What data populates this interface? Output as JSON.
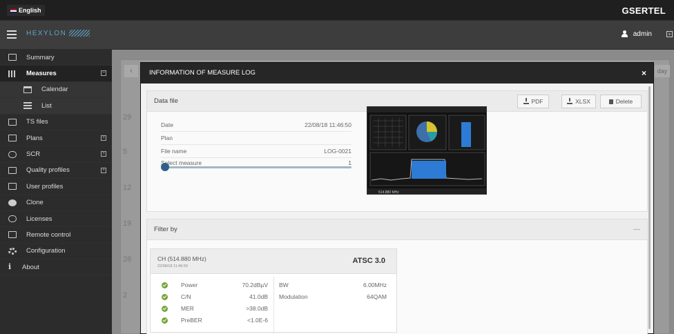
{
  "topbar": {
    "language": "English",
    "brand": "GSERTEL"
  },
  "header": {
    "logo_text": "HEXYLON",
    "user": "admin"
  },
  "sidebar": {
    "items": [
      {
        "label": "Summary",
        "icon": "summary-icon"
      },
      {
        "label": "Measures",
        "icon": "bar-chart-icon",
        "active": true,
        "expand": "⊟"
      },
      {
        "label": "Calendar",
        "icon": "calendar-icon",
        "sub": true
      },
      {
        "label": "List",
        "icon": "list-icon",
        "sub": true
      },
      {
        "label": "TS files",
        "icon": "ts-files-icon"
      },
      {
        "label": "Plans",
        "icon": "plans-icon",
        "expand": "⊞"
      },
      {
        "label": "SCR",
        "icon": "scr-icon",
        "expand": "⊞"
      },
      {
        "label": "Quality profiles",
        "icon": "quality-profiles-icon",
        "expand": "⊞"
      },
      {
        "label": "User profiles",
        "icon": "user-profiles-icon"
      },
      {
        "label": "Clone",
        "icon": "clone-icon"
      },
      {
        "label": "Licenses",
        "icon": "licenses-icon"
      },
      {
        "label": "Remote control",
        "icon": "remote-control-icon"
      },
      {
        "label": "Configuration",
        "icon": "gear-icon"
      },
      {
        "label": "About",
        "icon": "info-icon"
      }
    ]
  },
  "calendar": {
    "prev": "‹",
    "today": "day",
    "weeks": [
      "29",
      "5",
      "12",
      "19",
      "26",
      "2"
    ]
  },
  "modal": {
    "title": "INFORMATION OF MEASURE LOG",
    "close": "×",
    "data_file": {
      "heading": "Data file",
      "buttons": {
        "pdf": "PDF",
        "xlsx": "XLSX",
        "delete": "Delete"
      },
      "date_label": "Date",
      "date_value": "22/08/18 11:46:50",
      "plan_label": "Plan",
      "plan_value": "",
      "file_name_label": "File name",
      "file_name_value": "LOG-0021",
      "select_measure_label": "Select measure",
      "select_measure_value": "1",
      "screenshot_freq": "514.880 MHz"
    },
    "filter": {
      "heading": "Filter by",
      "collapse": "—",
      "card": {
        "title": "CH (514.880 MHz)",
        "time": "22/08/18 11:46:50",
        "standard": "ATSC 3.0",
        "left": [
          {
            "label": "Power",
            "value": "70.2dBµV"
          },
          {
            "label": "C/N",
            "value": "41.0dB"
          },
          {
            "label": "MER",
            "value": ">38.0dB"
          },
          {
            "label": "PreBER",
            "value": "<1.0E-6"
          }
        ],
        "right": [
          {
            "label": "BW",
            "value": "6.00MHz"
          },
          {
            "label": "Modulation",
            "value": "64QAM"
          }
        ]
      }
    }
  },
  "colors": {
    "accent": "#2f5f88",
    "check": "#76a63a",
    "header_bg": "#262626"
  }
}
